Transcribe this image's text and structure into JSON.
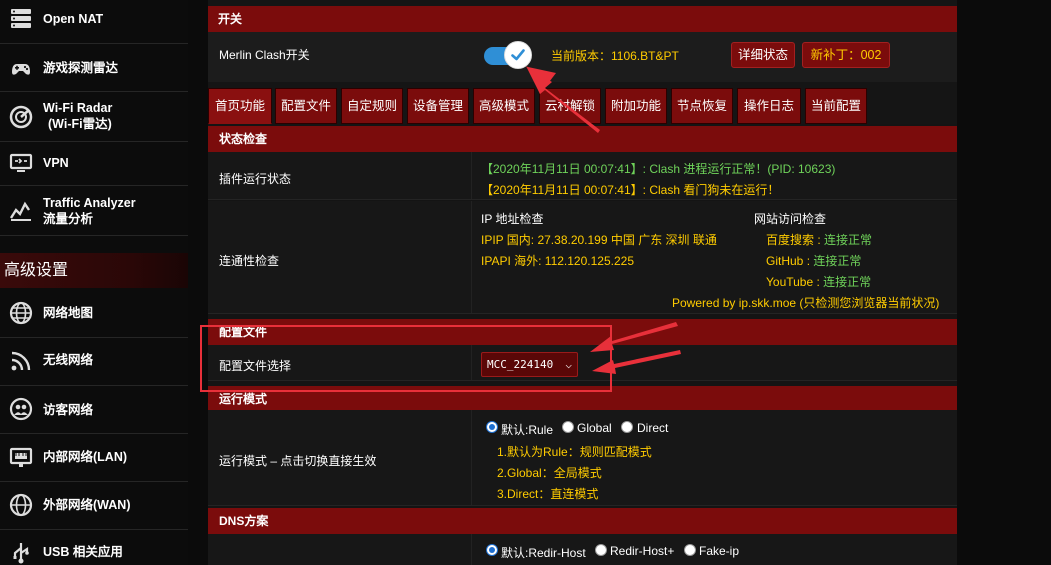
{
  "sidebar": {
    "items_top": [
      {
        "icon": "open-nat-icon",
        "label": "Open NAT",
        "sub": ""
      },
      {
        "icon": "game-radar-icon",
        "label": "游戏探测雷达",
        "sub": ""
      },
      {
        "icon": "wifi-radar-icon",
        "label": "Wi-Fi Radar",
        "sub": "(Wi-Fi雷达)"
      },
      {
        "icon": "vpn-icon",
        "label": "VPN",
        "sub": ""
      },
      {
        "icon": "traffic-analyzer-icon",
        "label": "Traffic Analyzer",
        "sub": "流量分析"
      }
    ],
    "section_heading": "高级设置",
    "items_advanced": [
      {
        "icon": "network-map-icon",
        "label": "网络地图"
      },
      {
        "icon": "wireless-icon",
        "label": "无线网络"
      },
      {
        "icon": "guest-network-icon",
        "label": "访客网络"
      },
      {
        "icon": "lan-icon",
        "label": "内部网络(LAN)"
      },
      {
        "icon": "wan-icon",
        "label": "外部网络(WAN)"
      },
      {
        "icon": "usb-icon",
        "label": "USB 相关应用"
      }
    ]
  },
  "switch_section": {
    "title": "开关",
    "label": "Merlin Clash开关",
    "toggle_on": true,
    "version": "当前版本：1106.BT&PT",
    "details_button": "详细状态",
    "patch_button": "新补丁：002"
  },
  "tabs": [
    "首页功能",
    "配置文件",
    "自定规则",
    "设备管理",
    "高级模式",
    "云村解锁",
    "附加功能",
    "节点恢复",
    "操作日志",
    "当前配置"
  ],
  "active_tab": 0,
  "status_section": {
    "title": "状态检查",
    "plugin_label": "插件运行状态",
    "status_line1": "【2020年11月11日 00:07:41】: Clash 进程运行正常！(PID: 10623)",
    "status_line2": "【2020年11月11日 00:07:41】: Clash 看门狗未在运行！",
    "connectivity_label": "连通性检查",
    "ip_heading": "IP 地址检查",
    "ipip_line": "IPIP  国内: 27.38.20.199 中国 广东 深圳 联通",
    "ipapi_line": "IPAPI 海外: 112.120.125.225",
    "web_heading": "网站访问检查",
    "sites": [
      {
        "name": "百度搜索",
        "status": "连接正常"
      },
      {
        "name": "GitHub",
        "status": "连接正常"
      },
      {
        "name": "YouTube",
        "status": "连接正常"
      }
    ],
    "powered_by": "Powered by ip.skk.moe (只检测您浏览器当前状况)"
  },
  "config_section": {
    "title": "配置文件",
    "select_label": "配置文件选择",
    "selected_value": "MCC_224140"
  },
  "mode_section": {
    "title": "运行模式",
    "label": "运行模式 – 点击切换直接生效",
    "options": [
      "默认:Rule",
      "Global",
      "Direct"
    ],
    "selected": 0,
    "notes": [
      "1.默认为Rule：规则匹配模式",
      "2.Global：全局模式",
      "3.Direct：直连模式"
    ]
  },
  "dns_section": {
    "title": "DNS方案",
    "options": [
      "默认:Redir-Host",
      "Redir-Host+",
      "Fake-ip"
    ],
    "selected": 0
  },
  "colors": {
    "accent_red": "#7b0c0c",
    "status_green": "#6fd35a",
    "highlight_yellow": "#ffcc00",
    "annotation_red": "#e8303a",
    "toggle_blue": "#2f8fd6"
  }
}
